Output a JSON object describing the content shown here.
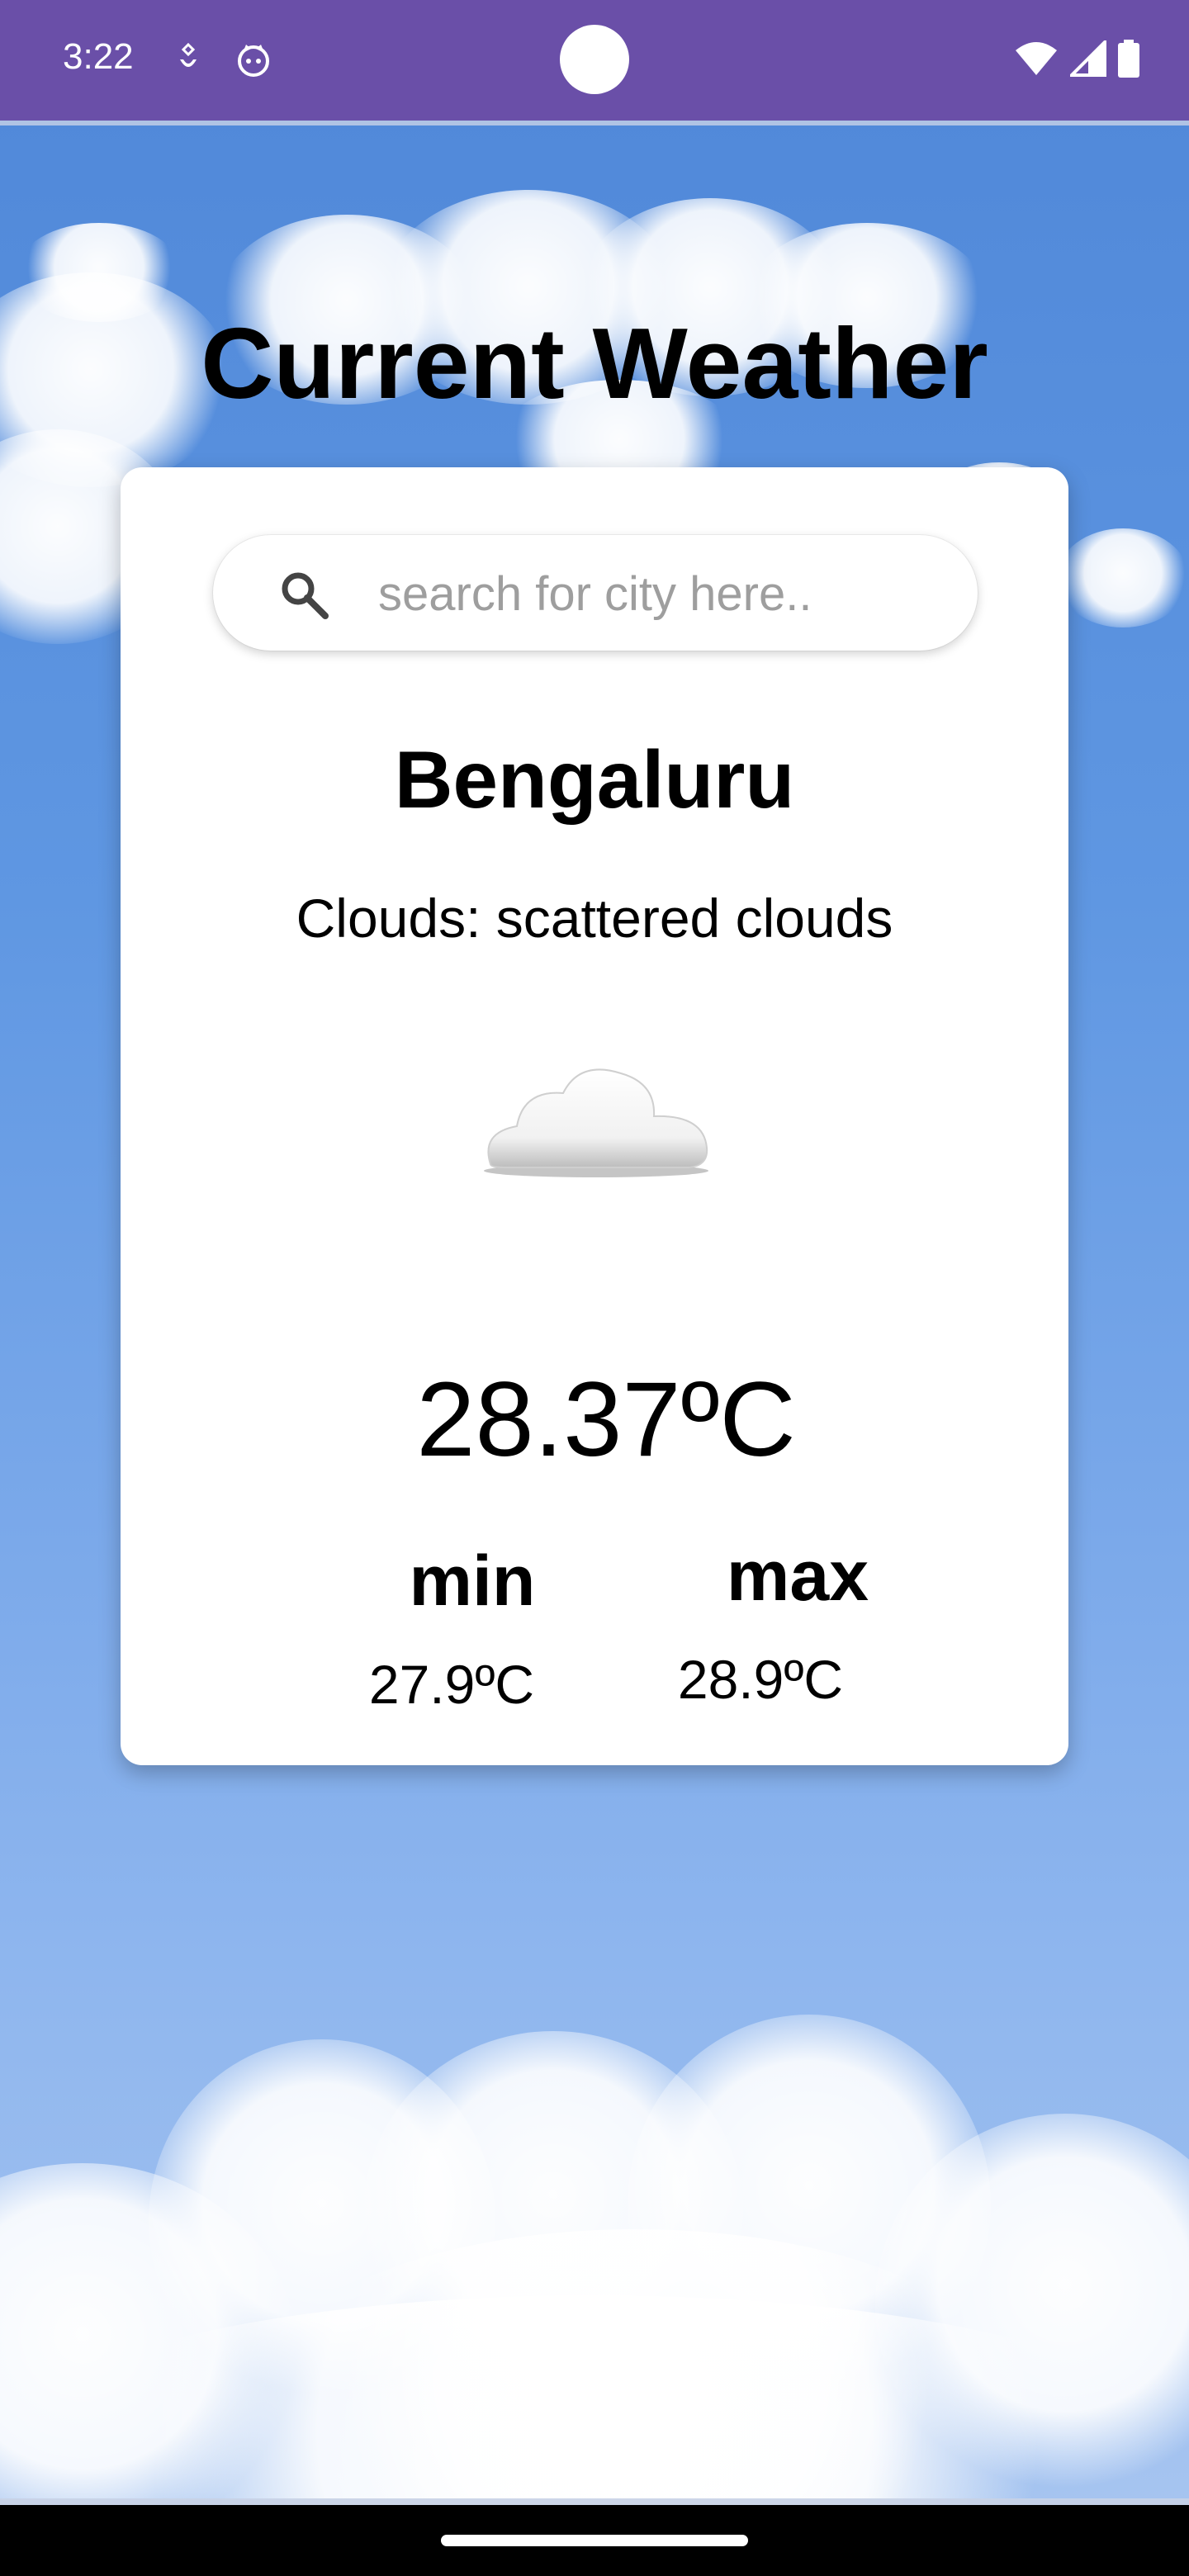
{
  "status_bar": {
    "time": "3:22",
    "icons": [
      "notification-icon",
      "app-notification-icon",
      "wifi-icon",
      "cellular-signal-icon",
      "battery-icon"
    ]
  },
  "page": {
    "title": "Current Weather"
  },
  "search": {
    "placeholder": "search for city here..",
    "value": ""
  },
  "weather": {
    "city": "Bengaluru",
    "condition": "Clouds: scattered clouds",
    "icon": "cloud-icon",
    "temperature": "28.37ºC",
    "min_label": "min",
    "min_value": "27.9ºC",
    "max_label": "max",
    "max_value": "28.9ºC"
  },
  "colors": {
    "status_bar": "#6a4fa8",
    "sky": "#5f97e2",
    "card": "#ffffff",
    "text": "#000000",
    "placeholder": "#9e9e9e"
  }
}
